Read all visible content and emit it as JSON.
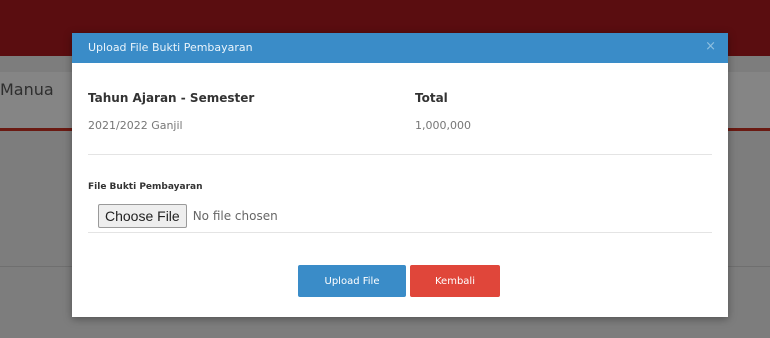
{
  "background": {
    "page_title": "Manua"
  },
  "modal": {
    "title": "Upload File Bukti Pembayaran",
    "close_symbol": "×",
    "columns": [
      {
        "label": "Tahun Ajaran - Semester",
        "value": "2021/2022 Ganjil"
      },
      {
        "label": "Total",
        "value": "1,000,000"
      }
    ],
    "file_field": {
      "label": "File Bukti Pembayaran",
      "button_label": "Choose File",
      "status": "No file chosen"
    },
    "buttons": {
      "upload": "Upload File",
      "back": "Kembali"
    }
  },
  "colors": {
    "header": "#3a8cc8",
    "upload_button": "#3a8cc8",
    "back_button": "#e0463a",
    "topbar": "#5a0d10"
  }
}
